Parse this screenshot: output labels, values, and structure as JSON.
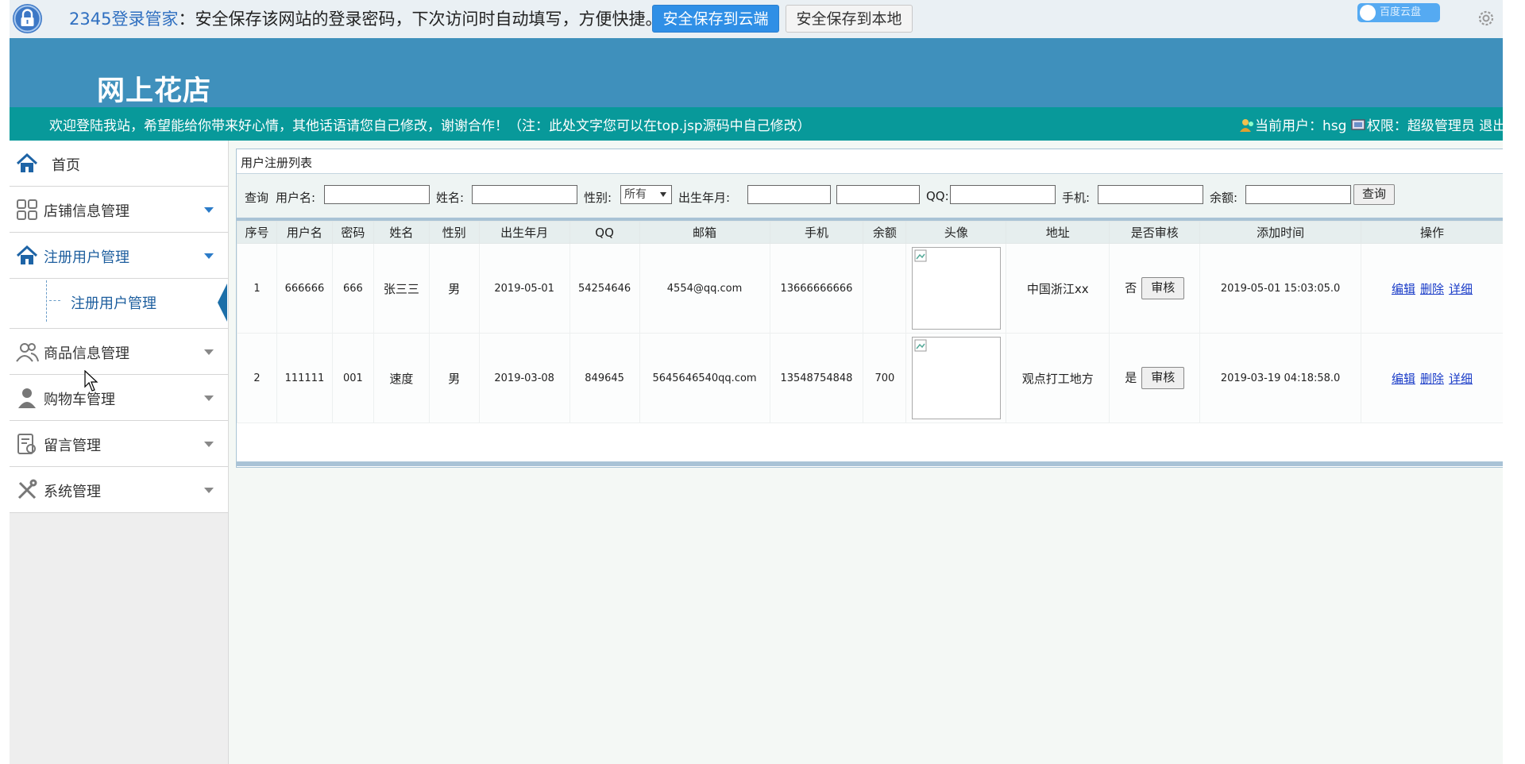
{
  "password_bar": {
    "brand": "2345登录管家",
    "message": "：安全保存该网站的登录密码，下次访问时自动填写，方便快捷。",
    "save_cloud_label": "安全保存到云端",
    "save_local_label": "安全保存到本地",
    "pill_text": "百度云盘"
  },
  "header": {
    "site_title": "网上花店",
    "welcome": "欢迎登陆我站，希望能给你带来好心情，其他话语请您自己修改，谢谢合作！（注：此处文字您可以在top.jsp源码中自己修改）",
    "current_user_label": "当前用户：hsg",
    "permission_label": "权限：超级管理员",
    "logout_label": "退出"
  },
  "sidebar": {
    "items": [
      {
        "label": "首页",
        "icon": "home-icon"
      },
      {
        "label": "店铺信息管理",
        "icon": "grid-icon"
      },
      {
        "label": "注册用户管理",
        "icon": "home-icon"
      },
      {
        "label": "商品信息管理",
        "icon": "users-icon"
      },
      {
        "label": "购物车管理",
        "icon": "person-icon"
      },
      {
        "label": "留言管理",
        "icon": "message-icon"
      },
      {
        "label": "系统管理",
        "icon": "tools-icon"
      }
    ],
    "sub_item": "注册用户管理",
    "active_color": "#1d5e9e"
  },
  "panel": {
    "title": "用户注册列表",
    "search": {
      "query_label": "查询",
      "username_label": "用户名:",
      "name_label": "姓名:",
      "gender_label": "性别:",
      "gender_value": "所有",
      "birth_label": "出生年月:",
      "qq_label": "QQ:",
      "phone_label": "手机:",
      "balance_label": "余额:",
      "query_button": "查询"
    },
    "columns": [
      "序号",
      "用户名",
      "密码",
      "姓名",
      "性别",
      "出生年月",
      "QQ",
      "邮箱",
      "手机",
      "余额",
      "头像",
      "地址",
      "是否审核",
      "添加时间",
      "操作"
    ],
    "rows": [
      {
        "no": "1",
        "username": "666666",
        "password": "666",
        "name": "张三三",
        "gender": "男",
        "birth": "2019-05-01",
        "qq": "54254646",
        "email": "4554@qq.com",
        "phone": "13666666666",
        "balance": "",
        "address": "中国浙江xx",
        "audited": "否",
        "audit_button": "审核",
        "added": "2019-05-01 15:03:05.0",
        "edit": "编辑",
        "delete": "删除",
        "detail": "详细"
      },
      {
        "no": "2",
        "username": "111111",
        "password": "001",
        "name": "速度",
        "gender": "男",
        "birth": "2019-03-08",
        "qq": "849645",
        "email": "5645646540qq.com",
        "phone": "13548754848",
        "balance": "700",
        "address": "观点打工地方",
        "audited": "是",
        "audit_button": "审核",
        "added": "2019-03-19 04:18:58.0",
        "edit": "编辑",
        "delete": "删除",
        "detail": "详细"
      }
    ]
  }
}
